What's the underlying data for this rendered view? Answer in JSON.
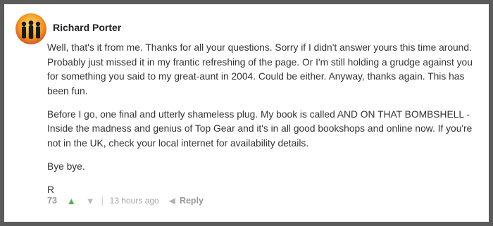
{
  "comment": {
    "author": "Richard Porter",
    "paragraphs": [
      "Well, that's it from me. Thanks for all your questions. Sorry if I didn't answer yours this time around. Probably just missed it in my frantic refreshing of the page. Or I'm still holding a grudge against you for something you said to my great-aunt in 2004. Could be either. Anyway, thanks again. This has been fun.",
      "Before I go, one final and utterly shameless plug. My book is called AND ON THAT BOMBSHELL - Inside the madness and genius of Top Gear and it's in all good bookshops and online now. If you're not in the UK, check your local internet for availability details.",
      "Bye bye.",
      "R"
    ],
    "votes": "73",
    "timestamp": "13 hours ago",
    "reply_label": "Reply"
  },
  "icons": {
    "avatar": "avatar-image",
    "upvote": "upvote-arrow-icon",
    "downvote": "downvote-arrow-icon",
    "reply": "reply-arrow-icon"
  },
  "colors": {
    "background": "#5b5b5b",
    "card": "#ffffff",
    "upvote": "#4caf50",
    "muted": "#9a9a9a"
  }
}
